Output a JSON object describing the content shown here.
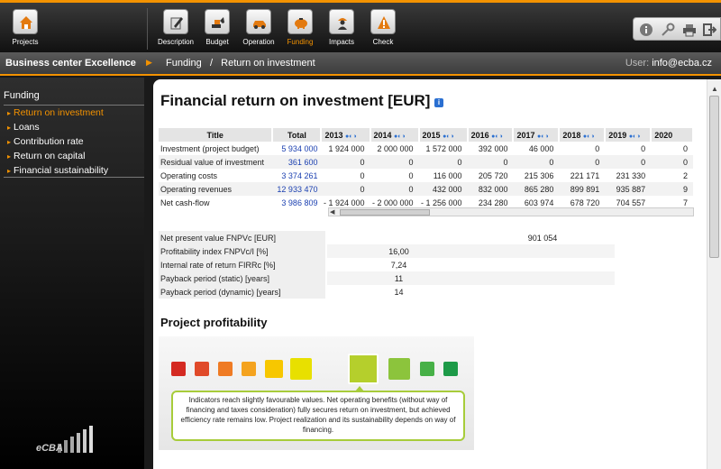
{
  "toolbar": {
    "projects": "Projects",
    "items": [
      {
        "label": "Description"
      },
      {
        "label": "Budget"
      },
      {
        "label": "Operation"
      },
      {
        "label": "Funding"
      },
      {
        "label": "Impacts"
      },
      {
        "label": "Check"
      }
    ],
    "active": "Funding"
  },
  "breadcrumb": {
    "company": "Business center Excellence",
    "section": "Funding",
    "separator": "/",
    "page": "Return on investment",
    "user_label": "User:",
    "user_email": "info@ecba.cz"
  },
  "sidebar": {
    "heading": "Funding",
    "items": [
      {
        "label": "Return on investment"
      },
      {
        "label": "Loans"
      },
      {
        "label": "Contribution rate"
      },
      {
        "label": "Return on capital"
      },
      {
        "label": "Financial sustainability"
      }
    ],
    "logo_text": "eCBA"
  },
  "main": {
    "title": "Financial return on investment [EUR]",
    "info_icon": "i",
    "table": {
      "headers": [
        "Title",
        "Total",
        "2013",
        "2014",
        "2015",
        "2016",
        "2017",
        "2018",
        "2019",
        "2020"
      ],
      "rows": [
        {
          "title": "Investment (project budget)",
          "total": "5 934 000",
          "values": [
            "1 924 000",
            "2 000 000",
            "1 572 000",
            "392 000",
            "46 000",
            "0",
            "0",
            "0"
          ]
        },
        {
          "title": "Residual value of investment",
          "total": "361 600",
          "values": [
            "0",
            "0",
            "0",
            "0",
            "0",
            "0",
            "0",
            "0"
          ]
        },
        {
          "title": "Operating costs",
          "total": "3 374 261",
          "values": [
            "0",
            "0",
            "116 000",
            "205 720",
            "215 306",
            "221 171",
            "231 330",
            "2"
          ]
        },
        {
          "title": "Operating revenues",
          "total": "12 933 470",
          "values": [
            "0",
            "0",
            "432 000",
            "832 000",
            "865 280",
            "899 891",
            "935 887",
            "9"
          ]
        },
        {
          "title": "Net cash-flow",
          "total": "3 986 809",
          "values": [
            "- 1 924 000",
            "- 2 000 000",
            "- 1 256 000",
            "234 280",
            "603 974",
            "678 720",
            "704 557",
            "7"
          ]
        }
      ]
    },
    "indicators": [
      {
        "label": "Net present value FNPVc [EUR]",
        "center": "",
        "right": "901 054"
      },
      {
        "label": "Profitability index FNPVc/I [%]",
        "center": "16,00",
        "right": ""
      },
      {
        "label": "Internal rate of return FIRRc [%]",
        "center": "7,24",
        "right": ""
      },
      {
        "label": "Payback period (static) [years]",
        "center": "11",
        "right": ""
      },
      {
        "label": "Payback period (dynamic) [years]",
        "center": "14",
        "right": ""
      }
    ],
    "profitability": {
      "heading": "Project profitability",
      "scale_colors": [
        "#d42a22",
        "#e04a2a",
        "#ef7b24",
        "#f4a31f",
        "#f7c700",
        "#e8e000",
        "#b5cf2c",
        "#8cc43c",
        "#47b047",
        "#1d9a48"
      ],
      "selected_index": 6,
      "text": "Indicators reach slightly favourable values. Net operating benefits (without way of financing and taxes consideration) fully secures return on investment, but achieved efficiency rate remains low. Project realization and its sustainability depends on way of financing."
    }
  }
}
